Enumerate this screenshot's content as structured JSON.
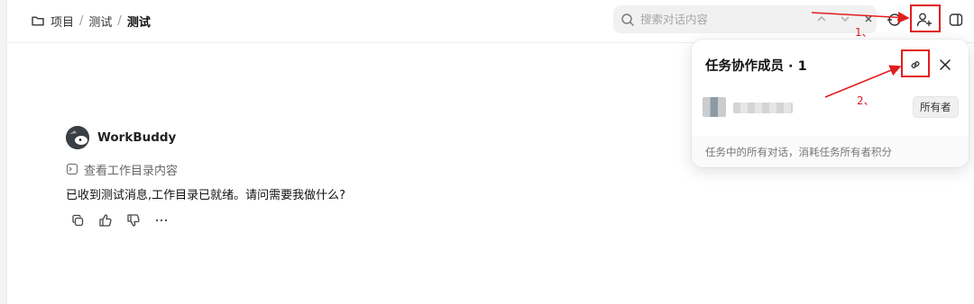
{
  "breadcrumb": {
    "items": [
      "项目",
      "测试"
    ],
    "current": "测试",
    "separator": "/"
  },
  "search": {
    "placeholder": "搜索对话内容"
  },
  "popover": {
    "title": "任务协作成员 · 1",
    "owner_label": "所有者",
    "footer": "任务中的所有对话，消耗任务所有者积分"
  },
  "message": {
    "sender": "WorkBuddy",
    "view_dir": "查看工作目录内容",
    "text": "已收到测试消息,工作目录已就绪。请问需要我做什么?"
  },
  "annotations": {
    "step1": "1、",
    "step2": "2、"
  },
  "icons": {
    "folder": "folder-icon",
    "search": "search-icon",
    "add_user": "add-user-icon",
    "link": "link-icon",
    "close": "close-icon",
    "sync": "sync-icon",
    "panel": "panel-icon",
    "copy": "copy-icon",
    "thumbs_up": "thumbs-up-icon",
    "thumbs_down": "thumbs-down-icon",
    "more": "more-icon",
    "terminal": "terminal-icon"
  },
  "colors": {
    "annotation_red": "#e11d1d",
    "badge_bg": "#f0f0f0"
  }
}
